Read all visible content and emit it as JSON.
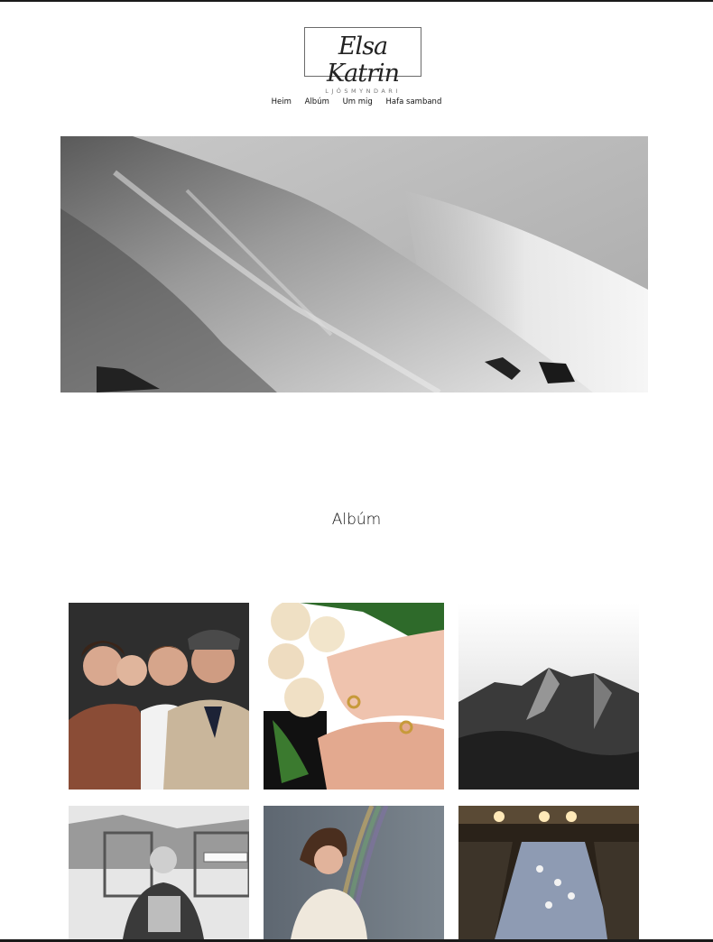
{
  "site": {
    "logo_script": "Elsa Katrin",
    "logo_subtitle": "LJÓSMYNDARI"
  },
  "nav": {
    "items": [
      {
        "label": "Heim"
      },
      {
        "label": "Albúm"
      },
      {
        "label": "Um mig"
      },
      {
        "label": "Hafa samband"
      }
    ]
  },
  "hero": {
    "image": "snowy-mountain-slope-bw-photo"
  },
  "albums": {
    "title": "Albúm",
    "tiles": [
      {
        "image": "family-portrait-photo"
      },
      {
        "image": "wedding-hands-roses-photo"
      },
      {
        "image": "mountain-peak-bw-photo"
      },
      {
        "image": "man-on-ski-lift-bw-photo"
      },
      {
        "image": "woman-rainbow-portrait-photo"
      },
      {
        "image": "stage-performance-audience-photo"
      }
    ]
  },
  "colors": {
    "text": "#111111",
    "frame": "#1a1a1a",
    "logo_border": "#6b6b6b"
  }
}
